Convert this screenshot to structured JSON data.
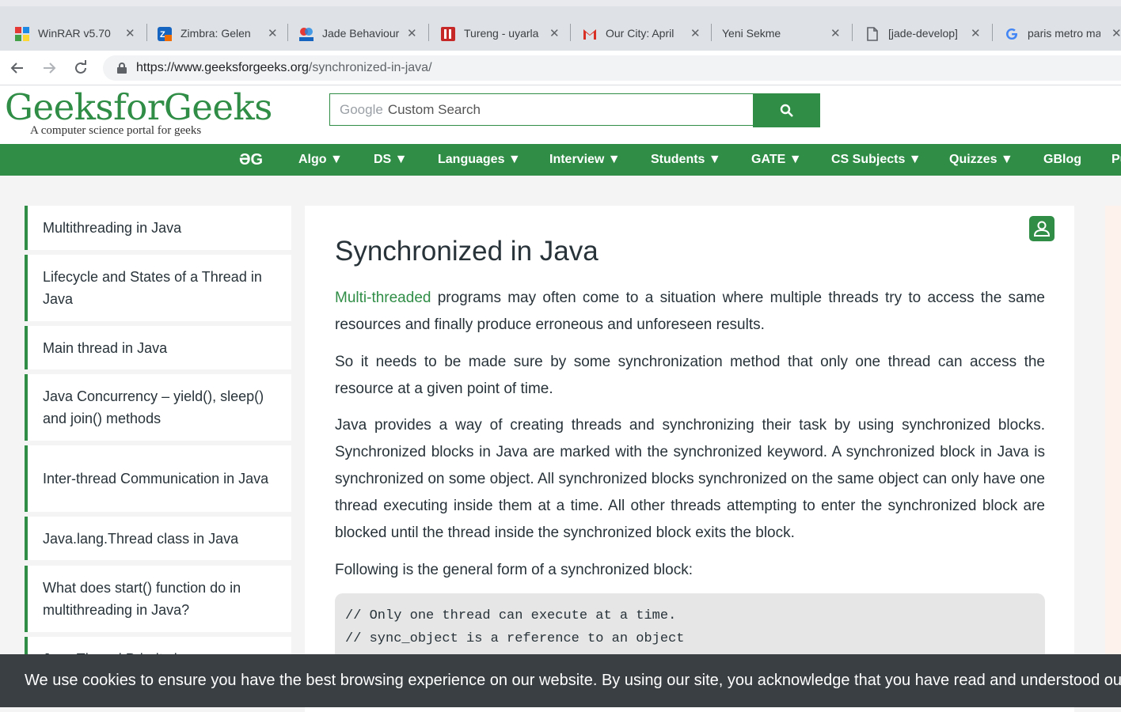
{
  "browser": {
    "tabs": [
      {
        "label": "WinRAR v5.70",
        "icon": "winrar-icon"
      },
      {
        "label": "Zimbra: Gelen",
        "icon": "zimbra-icon"
      },
      {
        "label": "Jade Behaviour",
        "icon": "diro-icon"
      },
      {
        "label": "Tureng - uyarla",
        "icon": "tureng-icon"
      },
      {
        "label": "Our City: April",
        "icon": "gmail-icon"
      },
      {
        "label": "Yeni Sekme",
        "icon": ""
      },
      {
        "label": "[jade-develop]",
        "icon": "file-icon"
      },
      {
        "label": "paris metro ma",
        "icon": "google-icon"
      }
    ],
    "url_host": "https://www.geeksforgeeks.org",
    "url_path": "/synchronized-in-java/"
  },
  "header": {
    "logo": "GeeksforGeeks",
    "tagline": "A computer science portal for geeks",
    "search_google": "Google",
    "search_placeholder": "Custom Search"
  },
  "nav": {
    "home_glyph": "ƏG",
    "items": [
      "Algo ▼",
      "DS ▼",
      "Languages ▼",
      "Interview ▼",
      "Students ▼",
      "GATE ▼",
      "CS Subjects ▼",
      "Quizzes ▼",
      "GBlog",
      "Pu"
    ]
  },
  "sidebar": {
    "items": [
      "Multithreading in Java",
      "Lifecycle and States of a Thread in Java",
      "Main thread in Java",
      "Java Concurrency – yield(), sleep() and join() methods",
      "Inter-thread Communication in Java",
      "Java.lang.Thread class in Java",
      "What does start() function do in multithreading in Java?",
      "Java Thread Priority in"
    ]
  },
  "article": {
    "title": "Synchronized in Java",
    "p1_link": "Multi-threaded",
    "p1_rest": " programs may often come to a situation where multiple threads try to access the same resources and finally produce erroneous and unforeseen results.",
    "p2": "So it needs to be made sure by some synchronization method that only one thread can access the resource at a given point of time.",
    "p3": "Java provides a way of creating threads and synchronizing their task by using synchronized blocks. Synchronized blocks in Java are marked with the synchronized keyword. A synchronized block in Java is synchronized on some object. All synchronized blocks synchronized on the same object can only have one thread executing inside them at a time. All other threads attempting to enter the synchronized block are blocked until the thread inside the synchronized block exits the block.",
    "p4": "Following is the general form of a synchronized block:",
    "code_line1": "// Only one thread can execute at a time.",
    "code_line2": "// sync_object is a reference to an object"
  },
  "cookie": {
    "text": "We use cookies to ensure you have the best browsing experience on our website. By using our site, you acknowledge that you have read and understood our"
  },
  "colors": {
    "brand_green": "#2f8d46",
    "cookie_bg": "#3a3f44"
  }
}
